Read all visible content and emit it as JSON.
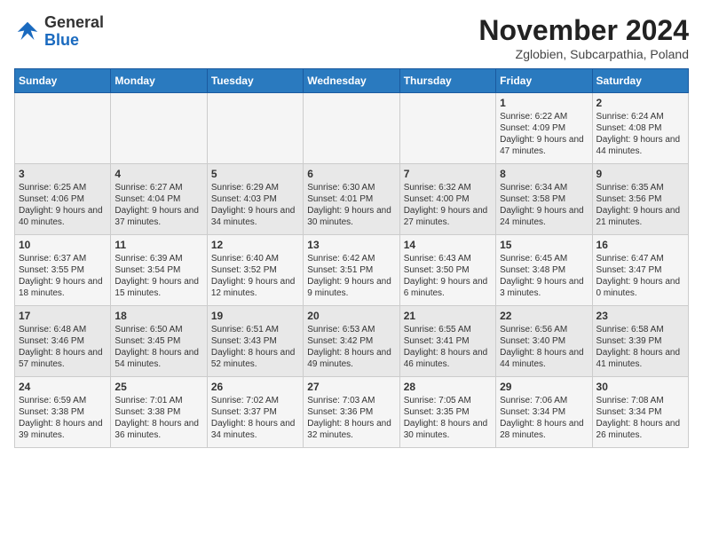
{
  "header": {
    "logo_general": "General",
    "logo_blue": "Blue",
    "title": "November 2024",
    "subtitle": "Zglobien, Subcarpathia, Poland"
  },
  "weekdays": [
    "Sunday",
    "Monday",
    "Tuesday",
    "Wednesday",
    "Thursday",
    "Friday",
    "Saturday"
  ],
  "weeks": [
    [
      {
        "day": "",
        "content": ""
      },
      {
        "day": "",
        "content": ""
      },
      {
        "day": "",
        "content": ""
      },
      {
        "day": "",
        "content": ""
      },
      {
        "day": "",
        "content": ""
      },
      {
        "day": "1",
        "content": "Sunrise: 6:22 AM\nSunset: 4:09 PM\nDaylight: 9 hours and 47 minutes."
      },
      {
        "day": "2",
        "content": "Sunrise: 6:24 AM\nSunset: 4:08 PM\nDaylight: 9 hours and 44 minutes."
      }
    ],
    [
      {
        "day": "3",
        "content": "Sunrise: 6:25 AM\nSunset: 4:06 PM\nDaylight: 9 hours and 40 minutes."
      },
      {
        "day": "4",
        "content": "Sunrise: 6:27 AM\nSunset: 4:04 PM\nDaylight: 9 hours and 37 minutes."
      },
      {
        "day": "5",
        "content": "Sunrise: 6:29 AM\nSunset: 4:03 PM\nDaylight: 9 hours and 34 minutes."
      },
      {
        "day": "6",
        "content": "Sunrise: 6:30 AM\nSunset: 4:01 PM\nDaylight: 9 hours and 30 minutes."
      },
      {
        "day": "7",
        "content": "Sunrise: 6:32 AM\nSunset: 4:00 PM\nDaylight: 9 hours and 27 minutes."
      },
      {
        "day": "8",
        "content": "Sunrise: 6:34 AM\nSunset: 3:58 PM\nDaylight: 9 hours and 24 minutes."
      },
      {
        "day": "9",
        "content": "Sunrise: 6:35 AM\nSunset: 3:56 PM\nDaylight: 9 hours and 21 minutes."
      }
    ],
    [
      {
        "day": "10",
        "content": "Sunrise: 6:37 AM\nSunset: 3:55 PM\nDaylight: 9 hours and 18 minutes."
      },
      {
        "day": "11",
        "content": "Sunrise: 6:39 AM\nSunset: 3:54 PM\nDaylight: 9 hours and 15 minutes."
      },
      {
        "day": "12",
        "content": "Sunrise: 6:40 AM\nSunset: 3:52 PM\nDaylight: 9 hours and 12 minutes."
      },
      {
        "day": "13",
        "content": "Sunrise: 6:42 AM\nSunset: 3:51 PM\nDaylight: 9 hours and 9 minutes."
      },
      {
        "day": "14",
        "content": "Sunrise: 6:43 AM\nSunset: 3:50 PM\nDaylight: 9 hours and 6 minutes."
      },
      {
        "day": "15",
        "content": "Sunrise: 6:45 AM\nSunset: 3:48 PM\nDaylight: 9 hours and 3 minutes."
      },
      {
        "day": "16",
        "content": "Sunrise: 6:47 AM\nSunset: 3:47 PM\nDaylight: 9 hours and 0 minutes."
      }
    ],
    [
      {
        "day": "17",
        "content": "Sunrise: 6:48 AM\nSunset: 3:46 PM\nDaylight: 8 hours and 57 minutes."
      },
      {
        "day": "18",
        "content": "Sunrise: 6:50 AM\nSunset: 3:45 PM\nDaylight: 8 hours and 54 minutes."
      },
      {
        "day": "19",
        "content": "Sunrise: 6:51 AM\nSunset: 3:43 PM\nDaylight: 8 hours and 52 minutes."
      },
      {
        "day": "20",
        "content": "Sunrise: 6:53 AM\nSunset: 3:42 PM\nDaylight: 8 hours and 49 minutes."
      },
      {
        "day": "21",
        "content": "Sunrise: 6:55 AM\nSunset: 3:41 PM\nDaylight: 8 hours and 46 minutes."
      },
      {
        "day": "22",
        "content": "Sunrise: 6:56 AM\nSunset: 3:40 PM\nDaylight: 8 hours and 44 minutes."
      },
      {
        "day": "23",
        "content": "Sunrise: 6:58 AM\nSunset: 3:39 PM\nDaylight: 8 hours and 41 minutes."
      }
    ],
    [
      {
        "day": "24",
        "content": "Sunrise: 6:59 AM\nSunset: 3:38 PM\nDaylight: 8 hours and 39 minutes."
      },
      {
        "day": "25",
        "content": "Sunrise: 7:01 AM\nSunset: 3:38 PM\nDaylight: 8 hours and 36 minutes."
      },
      {
        "day": "26",
        "content": "Sunrise: 7:02 AM\nSunset: 3:37 PM\nDaylight: 8 hours and 34 minutes."
      },
      {
        "day": "27",
        "content": "Sunrise: 7:03 AM\nSunset: 3:36 PM\nDaylight: 8 hours and 32 minutes."
      },
      {
        "day": "28",
        "content": "Sunrise: 7:05 AM\nSunset: 3:35 PM\nDaylight: 8 hours and 30 minutes."
      },
      {
        "day": "29",
        "content": "Sunrise: 7:06 AM\nSunset: 3:34 PM\nDaylight: 8 hours and 28 minutes."
      },
      {
        "day": "30",
        "content": "Sunrise: 7:08 AM\nSunset: 3:34 PM\nDaylight: 8 hours and 26 minutes."
      }
    ]
  ]
}
